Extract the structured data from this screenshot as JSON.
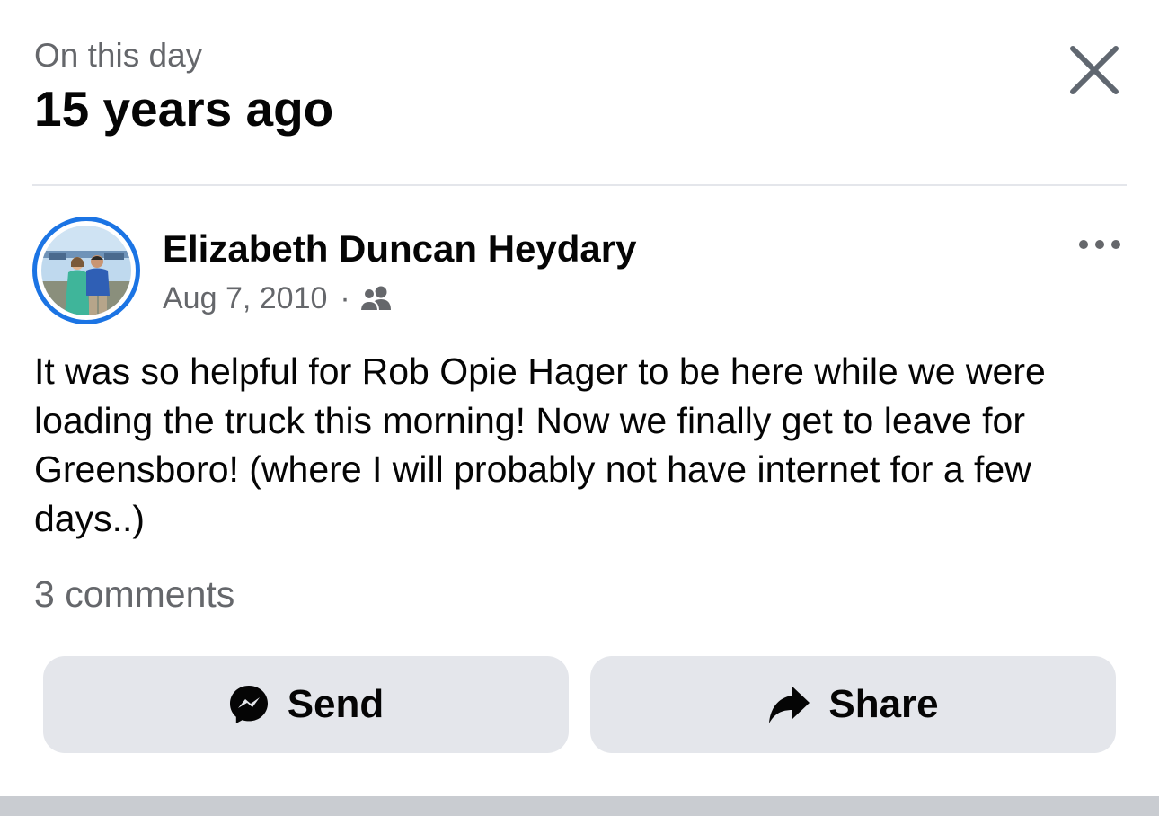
{
  "memory": {
    "kicker": "On this day",
    "title": "15 years ago"
  },
  "post": {
    "author": "Elizabeth Duncan Heydary",
    "date": "Aug 7, 2010",
    "separator": "·",
    "audience_icon": "friends-icon",
    "body": "It was so helpful for Rob Opie Hager to be here while we were loading the truck this morning! Now we finally get to leave for Greensboro! (where I will probably not have internet for a few days..)",
    "comments": "3 comments"
  },
  "actions": {
    "send_label": "Send",
    "send_icon": "messenger-icon",
    "share_label": "Share",
    "share_icon": "share-arrow-icon"
  },
  "icons": {
    "close": "close-icon",
    "more": "more-options-icon"
  },
  "colors": {
    "accent": "#1b74e4",
    "text_primary": "#050505",
    "text_secondary": "#65676b",
    "button_bg": "#e4e6eb"
  }
}
